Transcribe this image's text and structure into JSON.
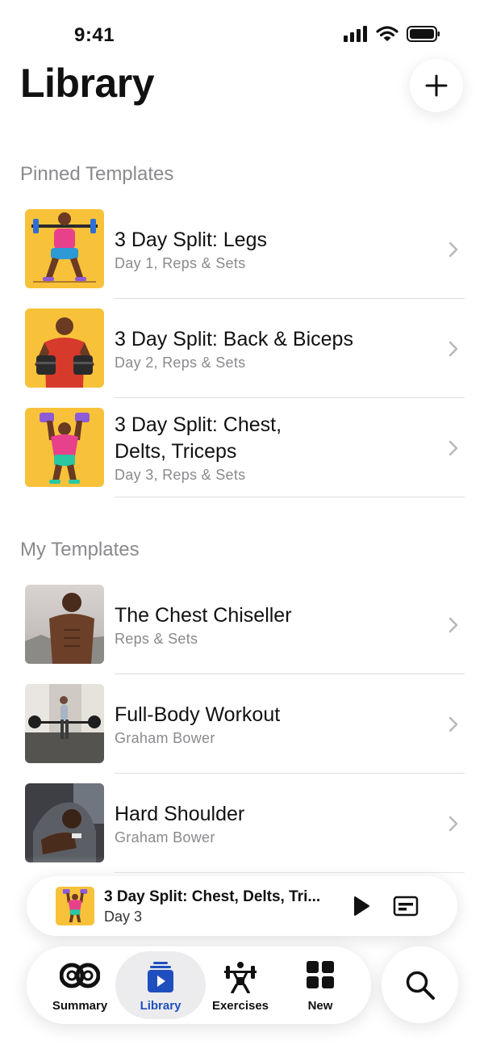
{
  "status_bar": {
    "time": "9:41"
  },
  "header": {
    "title": "Library",
    "add_icon": "plus-icon"
  },
  "pinned": {
    "header": "Pinned Templates",
    "items": [
      {
        "title": "3 Day Split: Legs",
        "subtitle": "Day 1, Reps & Sets"
      },
      {
        "title": "3 Day Split: Back & Biceps",
        "subtitle": "Day 2, Reps & Sets"
      },
      {
        "title": "3 Day Split: Chest, Delts, Triceps",
        "subtitle": "Day 3, Reps & Sets"
      }
    ]
  },
  "my_templates": {
    "header": "My Templates",
    "items": [
      {
        "title": "The Chest Chiseller",
        "subtitle": "Reps & Sets"
      },
      {
        "title": "Full-Body Workout",
        "subtitle": "Graham Bower"
      },
      {
        "title": "Hard Shoulder",
        "subtitle": "Graham Bower"
      }
    ]
  },
  "mini_player": {
    "title": "3 Day Split: Chest, Delts, Tri...",
    "subtitle": "Day 3"
  },
  "tabs": [
    {
      "label": "Summary",
      "icon": "rings-icon"
    },
    {
      "label": "Library",
      "icon": "library-icon"
    },
    {
      "label": "Exercises",
      "icon": "weightlifter-icon"
    },
    {
      "label": "New",
      "icon": "grid-icon"
    }
  ],
  "colors": {
    "accent": "#1f4fbf",
    "secondary_text": "#8a8a8e",
    "thumb_bg": "#f7c23a"
  }
}
